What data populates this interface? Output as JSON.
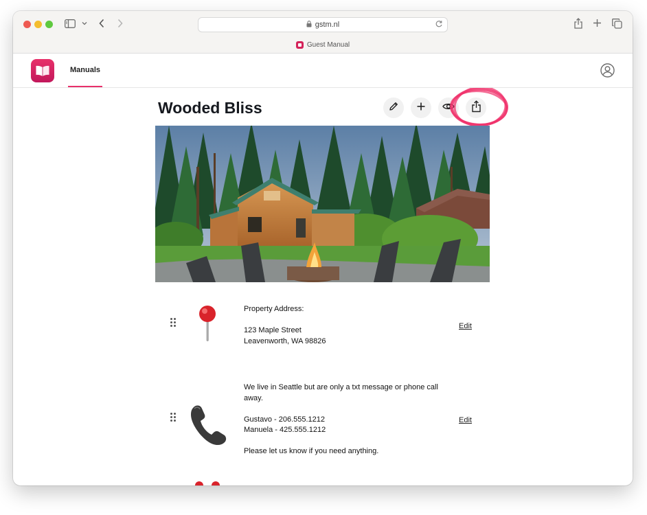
{
  "browser": {
    "url": "gstm.nl",
    "tab_title": "Guest Manual"
  },
  "nav": {
    "manuals_label": "Manuals"
  },
  "manual": {
    "title": "Wooded Bliss"
  },
  "items": [
    {
      "icon": "red-pushpin-icon",
      "lines": [
        "Property Address:",
        "",
        "123 Maple Street",
        "Leavenworth, WA 98826"
      ],
      "edit_label": "Edit"
    },
    {
      "icon": "telephone-receiver-icon",
      "lines": [
        "We live in Seattle but are only a txt message or phone call",
        "away.",
        "",
        "Gustavo - 206.555.1212",
        "Manuela - 425.555.1212",
        "",
        "Please let us know if you need anything."
      ],
      "edit_label": "Edit"
    }
  ],
  "colors": {
    "brand": "#e8306a",
    "highlight": "#f0336c"
  }
}
